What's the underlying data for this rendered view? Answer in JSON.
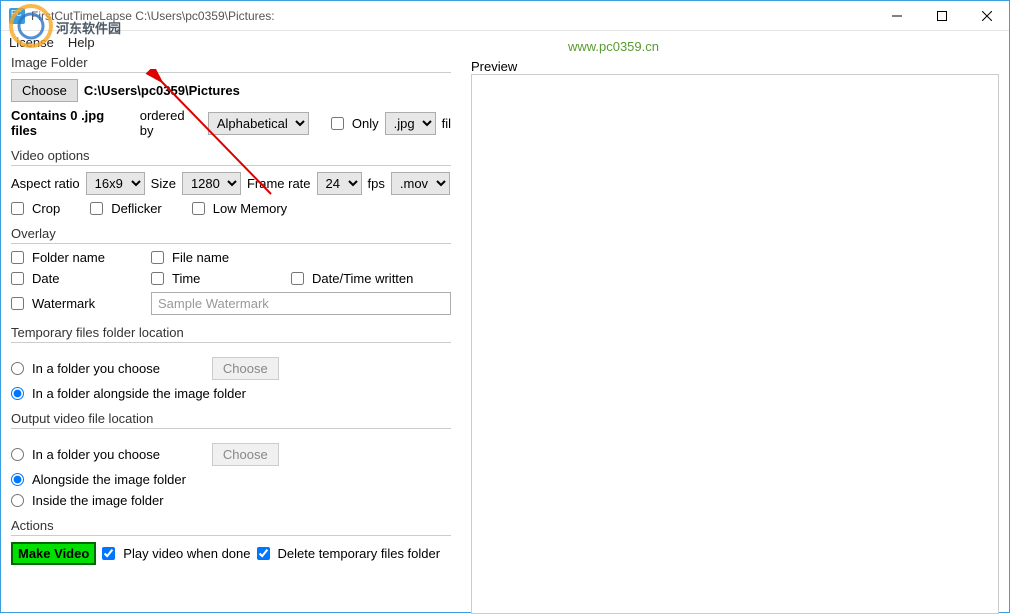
{
  "window": {
    "title": "FirstCutTimeLapse C:\\Users\\pc0359\\Pictures:",
    "min_tooltip": "Minimize",
    "max_tooltip": "Maximize",
    "close_tooltip": "Close"
  },
  "menu": {
    "license": "License",
    "help": "Help"
  },
  "imageFolder": {
    "label": "Image Folder",
    "choose": "Choose",
    "path": "C:\\Users\\pc0359\\Pictures",
    "contains": "Contains 0 .jpg files",
    "ordered_by": "ordered by",
    "order_value": "Alphabetical",
    "only": "Only",
    "ext": ".jpg",
    "fil": "fil"
  },
  "video": {
    "label": "Video options",
    "aspect_label": "Aspect ratio",
    "aspect_value": "16x9",
    "size_label": "Size",
    "size_value": "1280",
    "fr_label": "Frame rate",
    "fr_value": "24",
    "fps": "fps",
    "container": ".mov",
    "crop": "Crop",
    "deflicker": "Deflicker",
    "lowmem": "Low Memory"
  },
  "overlay": {
    "label": "Overlay",
    "folder_name": "Folder name",
    "file_name": "File name",
    "date": "Date",
    "time": "Time",
    "dtw": "Date/Time written",
    "watermark": "Watermark",
    "watermark_placeholder": "Sample Watermark"
  },
  "temp": {
    "label": "Temporary files folder location",
    "choose_folder": "In a folder you choose",
    "choose": "Choose",
    "alongside": "In a folder alongside the image folder"
  },
  "output": {
    "label": "Output video file location",
    "choose_folder": "In a folder you choose",
    "choose": "Choose",
    "alongside": "Alongside the image folder",
    "inside": "Inside the image folder"
  },
  "actions": {
    "label": "Actions",
    "make": "Make Video",
    "play": "Play video when done",
    "delete": "Delete temporary files folder"
  },
  "preview": {
    "label": "Preview"
  },
  "watermark_url": "www.pc0359.cn"
}
